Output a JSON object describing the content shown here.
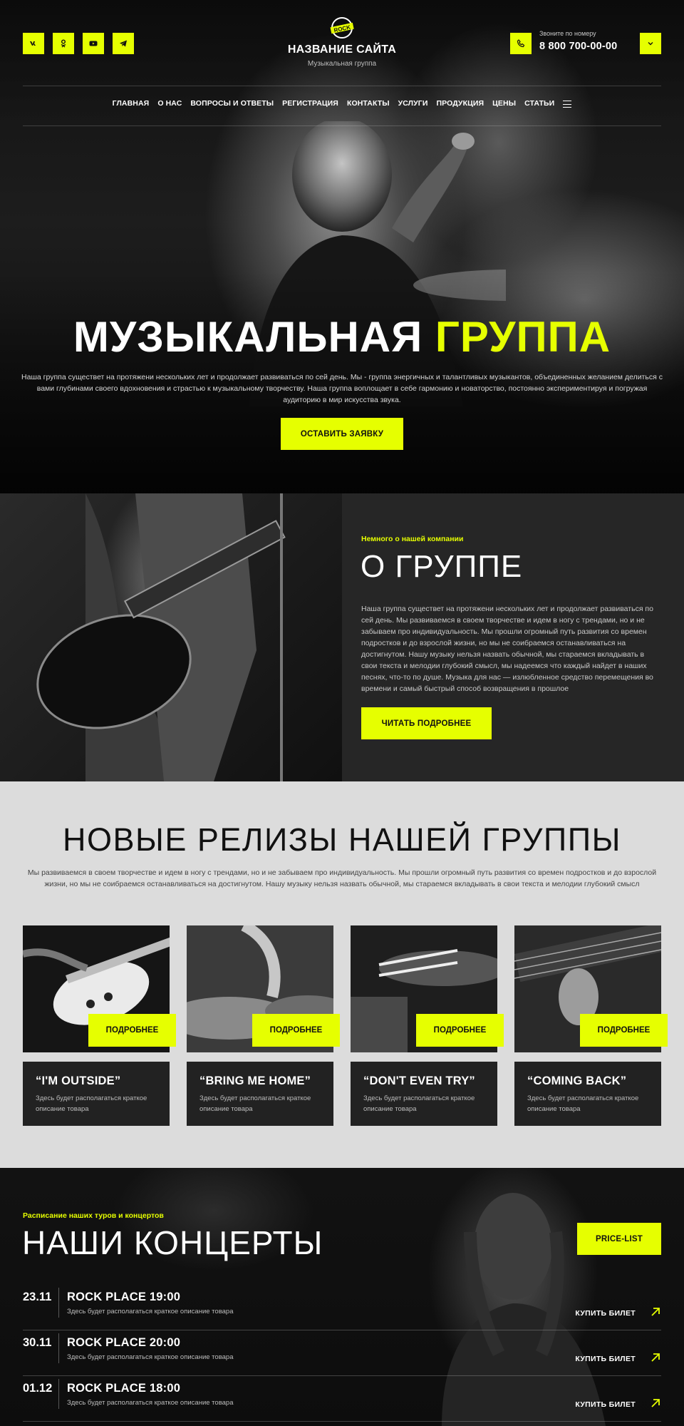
{
  "header": {
    "logo_text": "ROCK",
    "site_title": "НАЗВАНИЕ САЙТА",
    "site_subtitle": "Музыкальная группа",
    "phone_label": "Звоните по номеру",
    "phone_number": "8 800 700-00-00",
    "social": [
      "vk-icon",
      "odnoklassniki-icon",
      "youtube-icon",
      "telegram-icon"
    ]
  },
  "nav": {
    "items": [
      "ГЛАВНАЯ",
      "О НАС",
      "ВОПРОСЫ И ОТВЕТЫ",
      "РЕГИСТРАЦИЯ",
      "КОНТАКТЫ",
      "УСЛУГИ",
      "ПРОДУКЦИЯ",
      "ЦЕНЫ",
      "СТАТЬИ"
    ]
  },
  "hero": {
    "title_main": "МУЗЫКАЛЬНАЯ",
    "title_accent": "ГРУППА",
    "text": "Наша группа существет на протяжени нескольких лет и продолжает развиваться по сей день. Мы - группа энергичных и талантливых музыкантов, объединенных желанием делиться с вами глубинами своего вдохновения и страстью к музыкальному творчеству. Наша группа воплощает в себе гармонию и новаторство, постоянно экспериментируя и погружая аудиторию в мир искусства звука.",
    "cta": "ОСТАВИТЬ ЗАЯВКУ"
  },
  "about": {
    "kicker": "Немного о нашей компании",
    "title": "О ГРУППЕ",
    "text": "Наша группа существет на протяжени нескольких лет и продолжает развиваться по сей день. Мы развиваемся в своем творчестве и идем в ногу с трендами, но и не забываем про индивидуальность. Мы прошли огромный путь развития со времен подростков и до взрослой жизни, но мы не соибраемся останавливаться на достигнутом. Нашу музыку нельзя назвать обычной, мы стараемся вкладывать в свои текста и мелодии глубокий смысл, мы надеемся что каждый найдет в наших песнях, что-то по душе. Музыка для нас — излюбленное средство перемещения во времени и самый быстрый способ возвращения в прошлое",
    "cta": "ЧИТАТЬ ПОДРОБНЕЕ"
  },
  "releases": {
    "title": "НОВЫЕ РЕЛИЗЫ НАШЕЙ ГРУППЫ",
    "text": "Мы развиваемся в своем творчестве и идем в ногу с трендами, но  и не забываем про индивидуальность. Мы прошли огромный путь развития со времен подростков и до взрослой жизни, но мы не соибраемся останавливаться на достигнутом. Нашу музыку нельзя назвать обычной, мы стараемся вкладывать в свои текста и мелодии глубокий смысл",
    "more_label": "ПОДРОБНЕЕ",
    "cards": [
      {
        "title": "“I'M OUTSIDE”",
        "desc": "Здесь будет располагаться краткое описание товара"
      },
      {
        "title": "“BRING ME HOME”",
        "desc": "Здесь будет располагаться краткое описание товара"
      },
      {
        "title": "“DON'T EVEN TRY”",
        "desc": "Здесь будет располагаться краткое описание товара"
      },
      {
        "title": "“COMING BACK”",
        "desc": "Здесь будет располагаться краткое описание товара"
      }
    ]
  },
  "concerts": {
    "kicker": "Расписание наших туров и концертов",
    "title": "НАШИ КОНЦЕРТЫ",
    "price_btn": "PRICE-LIST",
    "ticket_label": "КУПИТЬ БИЛЕТ",
    "rows": [
      {
        "date": "23.11",
        "name": "ROCK PLACE 19:00",
        "desc": "Здесь будет располагаться краткое описание товара"
      },
      {
        "date": "30.11",
        "name": "ROCK PLACE 20:00",
        "desc": "Здесь будет располагаться краткое описание товара"
      },
      {
        "date": "01.12",
        "name": "ROCK PLACE 18:00",
        "desc": "Здесь будет располагаться краткое описание товара"
      }
    ]
  },
  "colors": {
    "accent": "#e6ff00",
    "dark": "#0b0b0b",
    "panel": "#262626",
    "light": "#dcdcdc"
  }
}
